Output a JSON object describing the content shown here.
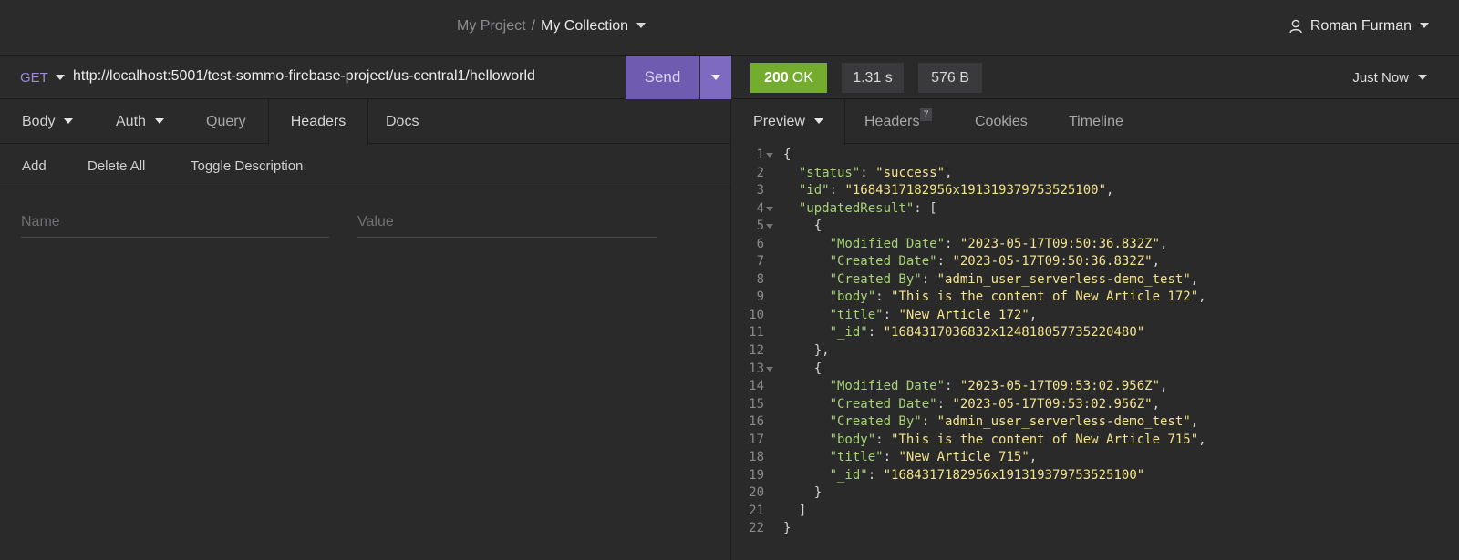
{
  "header": {
    "project": "My Project",
    "separator": "/",
    "collection": "My Collection",
    "user": "Roman Furman"
  },
  "request": {
    "method": "GET",
    "url": "http://localhost:5001/test-sommo-firebase-project/us-central1/helloworld",
    "send_label": "Send",
    "tabs": {
      "body": "Body",
      "auth": "Auth",
      "query": "Query",
      "headers": "Headers",
      "docs": "Docs"
    },
    "actions": {
      "add": "Add",
      "delete_all": "Delete All",
      "toggle_description": "Toggle Description"
    },
    "name_placeholder": "Name",
    "value_placeholder": "Value"
  },
  "response": {
    "status_code": "200",
    "status_text": "OK",
    "time": "1.31 s",
    "size": "576 B",
    "when": "Just Now",
    "tabs": {
      "preview": "Preview",
      "headers": "Headers",
      "headers_count": "7",
      "cookies": "Cookies",
      "timeline": "Timeline"
    },
    "lines": [
      {
        "n": "1",
        "fold": true,
        "parts": [
          [
            "p",
            "{"
          ]
        ]
      },
      {
        "n": "2",
        "parts": [
          [
            "p",
            "  "
          ],
          [
            "k",
            "\"status\""
          ],
          [
            "p",
            ": "
          ],
          [
            "s",
            "\"success\""
          ],
          [
            "p",
            ","
          ]
        ]
      },
      {
        "n": "3",
        "parts": [
          [
            "p",
            "  "
          ],
          [
            "k",
            "\"id\""
          ],
          [
            "p",
            ": "
          ],
          [
            "s",
            "\"1684317182956x191319379753525100\""
          ],
          [
            "p",
            ","
          ]
        ]
      },
      {
        "n": "4",
        "fold": true,
        "parts": [
          [
            "p",
            "  "
          ],
          [
            "k",
            "\"updatedResult\""
          ],
          [
            "p",
            ": ["
          ]
        ]
      },
      {
        "n": "5",
        "fold": true,
        "parts": [
          [
            "p",
            "    {"
          ]
        ]
      },
      {
        "n": "6",
        "parts": [
          [
            "p",
            "      "
          ],
          [
            "k",
            "\"Modified Date\""
          ],
          [
            "p",
            ": "
          ],
          [
            "s",
            "\"2023-05-17T09:50:36.832Z\""
          ],
          [
            "p",
            ","
          ]
        ]
      },
      {
        "n": "7",
        "parts": [
          [
            "p",
            "      "
          ],
          [
            "k",
            "\"Created Date\""
          ],
          [
            "p",
            ": "
          ],
          [
            "s",
            "\"2023-05-17T09:50:36.832Z\""
          ],
          [
            "p",
            ","
          ]
        ]
      },
      {
        "n": "8",
        "parts": [
          [
            "p",
            "      "
          ],
          [
            "k",
            "\"Created By\""
          ],
          [
            "p",
            ": "
          ],
          [
            "s",
            "\"admin_user_serverless-demo_test\""
          ],
          [
            "p",
            ","
          ]
        ]
      },
      {
        "n": "9",
        "parts": [
          [
            "p",
            "      "
          ],
          [
            "k",
            "\"body\""
          ],
          [
            "p",
            ": "
          ],
          [
            "s",
            "\"This is the content of New Article 172\""
          ],
          [
            "p",
            ","
          ]
        ]
      },
      {
        "n": "10",
        "parts": [
          [
            "p",
            "      "
          ],
          [
            "k",
            "\"title\""
          ],
          [
            "p",
            ": "
          ],
          [
            "s",
            "\"New Article 172\""
          ],
          [
            "p",
            ","
          ]
        ]
      },
      {
        "n": "11",
        "parts": [
          [
            "p",
            "      "
          ],
          [
            "k",
            "\"_id\""
          ],
          [
            "p",
            ": "
          ],
          [
            "s",
            "\"1684317036832x124818057735220480\""
          ]
        ]
      },
      {
        "n": "12",
        "parts": [
          [
            "p",
            "    },"
          ]
        ]
      },
      {
        "n": "13",
        "fold": true,
        "parts": [
          [
            "p",
            "    {"
          ]
        ]
      },
      {
        "n": "14",
        "parts": [
          [
            "p",
            "      "
          ],
          [
            "k",
            "\"Modified Date\""
          ],
          [
            "p",
            ": "
          ],
          [
            "s",
            "\"2023-05-17T09:53:02.956Z\""
          ],
          [
            "p",
            ","
          ]
        ]
      },
      {
        "n": "15",
        "parts": [
          [
            "p",
            "      "
          ],
          [
            "k",
            "\"Created Date\""
          ],
          [
            "p",
            ": "
          ],
          [
            "s",
            "\"2023-05-17T09:53:02.956Z\""
          ],
          [
            "p",
            ","
          ]
        ]
      },
      {
        "n": "16",
        "parts": [
          [
            "p",
            "      "
          ],
          [
            "k",
            "\"Created By\""
          ],
          [
            "p",
            ": "
          ],
          [
            "s",
            "\"admin_user_serverless-demo_test\""
          ],
          [
            "p",
            ","
          ]
        ]
      },
      {
        "n": "17",
        "parts": [
          [
            "p",
            "      "
          ],
          [
            "k",
            "\"body\""
          ],
          [
            "p",
            ": "
          ],
          [
            "s",
            "\"This is the content of New Article 715\""
          ],
          [
            "p",
            ","
          ]
        ]
      },
      {
        "n": "18",
        "parts": [
          [
            "p",
            "      "
          ],
          [
            "k",
            "\"title\""
          ],
          [
            "p",
            ": "
          ],
          [
            "s",
            "\"New Article 715\""
          ],
          [
            "p",
            ","
          ]
        ]
      },
      {
        "n": "19",
        "parts": [
          [
            "p",
            "      "
          ],
          [
            "k",
            "\"_id\""
          ],
          [
            "p",
            ": "
          ],
          [
            "s",
            "\"1684317182956x191319379753525100\""
          ]
        ]
      },
      {
        "n": "20",
        "parts": [
          [
            "p",
            "    }"
          ]
        ]
      },
      {
        "n": "21",
        "parts": [
          [
            "p",
            "  ]"
          ]
        ]
      },
      {
        "n": "22",
        "parts": [
          [
            "p",
            "}"
          ]
        ]
      }
    ]
  },
  "colors": {
    "accent": "#6f5cb0",
    "status_ok": "#74ad2e",
    "json_key": "#a6d276",
    "json_string": "#f2e38c"
  }
}
